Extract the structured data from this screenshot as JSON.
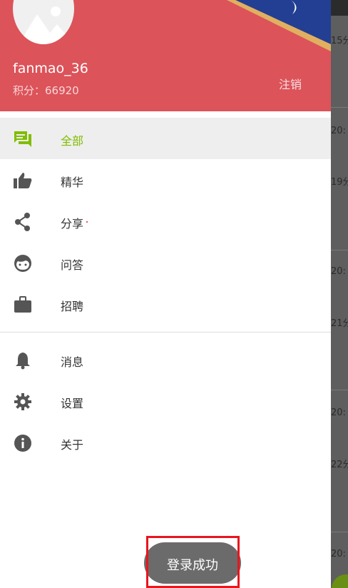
{
  "background_list": {
    "items": [
      "15分",
      "20:",
      "19分",
      "20:",
      "21分",
      "20:",
      "22分",
      "20:"
    ]
  },
  "drawer": {
    "header": {
      "username": "fanmao_36",
      "points": "积分：66920",
      "logout_label": "注销"
    },
    "menu": [
      {
        "label": "全部",
        "icon": "chat-icon"
      },
      {
        "label": "精华",
        "icon": "thumb-up-icon"
      },
      {
        "label": "分享",
        "icon": "share-icon"
      },
      {
        "label": "问答",
        "icon": "face-icon"
      },
      {
        "label": "招聘",
        "icon": "briefcase-icon"
      }
    ],
    "menu2": [
      {
        "label": "消息",
        "icon": "bell-icon"
      },
      {
        "label": "设置",
        "icon": "gear-icon"
      },
      {
        "label": "关于",
        "icon": "info-icon"
      }
    ]
  },
  "toast": {
    "text": "登录成功"
  },
  "colors": {
    "header_bg": "#dc535a",
    "accent": "#80bd01",
    "icon": "#555555",
    "toast_bg": "#6b6b6b",
    "highlight_frame": "#e8151e"
  }
}
